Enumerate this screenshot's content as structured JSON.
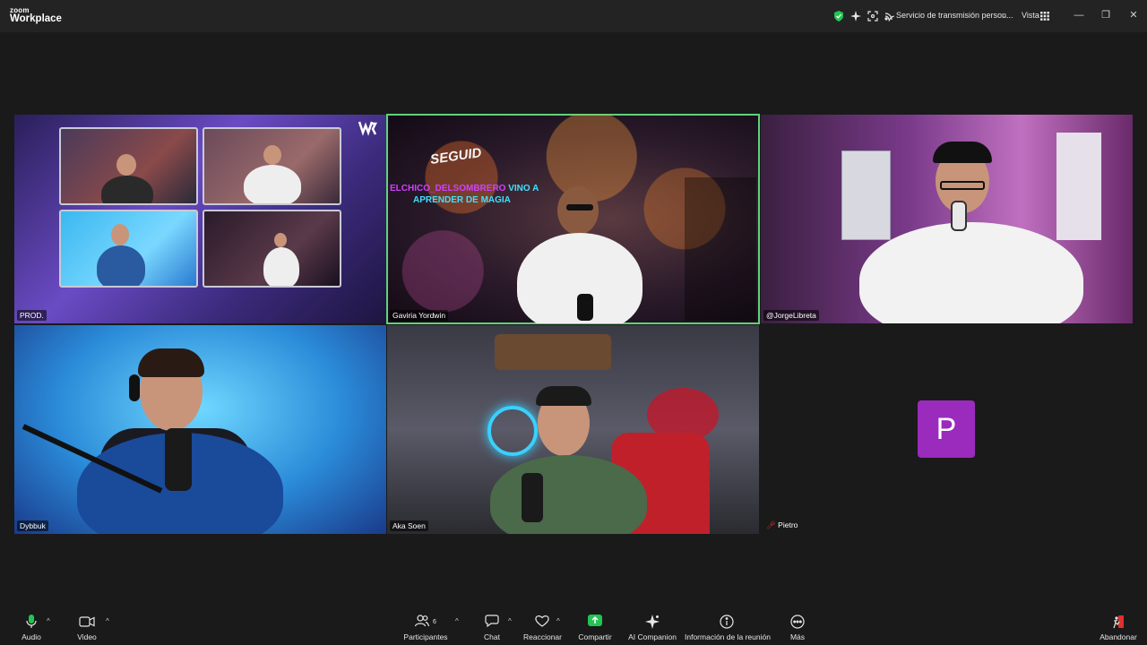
{
  "app": {
    "logo_small": "zoom",
    "logo_big": "Workplace"
  },
  "titlebar": {
    "stream_label": "Servicio de transmisión person...",
    "view_label": "Vista",
    "icons": [
      "shield-check-icon",
      "sparkle-icon",
      "fullscreen-icon",
      "stream-icon"
    ]
  },
  "tiles": [
    {
      "name": "PROD."
    },
    {
      "name": "Gaviria Yordwin",
      "active_speaker": true
    },
    {
      "name": "@JorgeLibreta"
    },
    {
      "name": "Dybbuk"
    },
    {
      "name": "Aka Soen"
    },
    {
      "name": "Pietro",
      "avatar_letter": "P",
      "muted": true
    }
  ],
  "overlay": {
    "stream_handle": "ELCHICO_DELSOMBRERO",
    "stream_msg1": "VINO A",
    "stream_msg2": "APRENDER DE MAGIA",
    "follow_text": "SEGUID"
  },
  "toolbar": {
    "audio": "Audio",
    "video": "Video",
    "participants": "Participantes",
    "participants_count": "6",
    "chat": "Chat",
    "react": "Reaccionar",
    "share": "Compartir",
    "ai": "AI Companion",
    "info": "Información de la reunión",
    "more": "Más",
    "leave": "Abandonar"
  },
  "colors": {
    "active_border": "#5fd37a",
    "share_green": "#23c552",
    "avatar_purple": "#9a2bbd"
  }
}
